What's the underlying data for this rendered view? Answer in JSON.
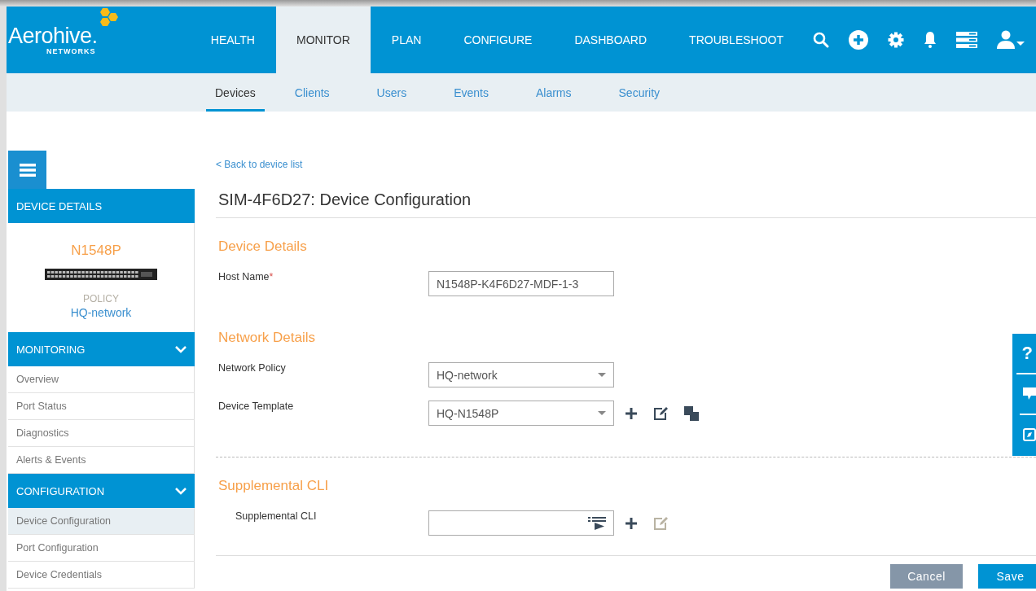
{
  "logo": {
    "name": "Aerohive.",
    "sub": "NETWORKS"
  },
  "nav": [
    {
      "label": "HEALTH",
      "selected": false
    },
    {
      "label": "MONITOR",
      "selected": true
    },
    {
      "label": "PLAN",
      "selected": false
    },
    {
      "label": "CONFIGURE",
      "selected": false
    },
    {
      "label": "DASHBOARD",
      "selected": false
    },
    {
      "label": "TROUBLESHOOT",
      "selected": false
    }
  ],
  "subnav": [
    {
      "label": "Devices",
      "selected": true
    },
    {
      "label": "Clients",
      "selected": false
    },
    {
      "label": "Users",
      "selected": false
    },
    {
      "label": "Events",
      "selected": false
    },
    {
      "label": "Alarms",
      "selected": false
    },
    {
      "label": "Security",
      "selected": false
    }
  ],
  "sidebar": {
    "header": "DEVICE DETAILS",
    "device": {
      "model": "N1548P",
      "policy_label": "POLICY",
      "policy": "HQ-network"
    },
    "sections": [
      {
        "title": "MONITORING",
        "expanded": true,
        "items": [
          {
            "label": "Overview",
            "selected": false
          },
          {
            "label": "Port Status",
            "selected": false
          },
          {
            "label": "Diagnostics",
            "selected": false
          },
          {
            "label": "Alerts & Events",
            "selected": false
          }
        ]
      },
      {
        "title": "CONFIGURATION",
        "expanded": true,
        "items": [
          {
            "label": "Device Configuration",
            "selected": true
          },
          {
            "label": "Port Configuration",
            "selected": false
          },
          {
            "label": "Device Credentials",
            "selected": false
          }
        ]
      }
    ]
  },
  "main": {
    "back_link": "< Back to device list",
    "title": "SIM-4F6D27: Device Configuration",
    "sections": [
      {
        "title": "Device Details",
        "fields": [
          {
            "kind": "text",
            "label": "Host Name",
            "required_mark": "*",
            "value": "N1548P-K4F6D27-MDF-1-3"
          }
        ]
      },
      {
        "title": "Network Details",
        "fields": [
          {
            "kind": "select",
            "label": "Network Policy",
            "value": "HQ-network"
          },
          {
            "kind": "select",
            "label": "Device Template",
            "value": "HQ-N1548P",
            "actions": [
              {
                "kind": "add",
                "disabled": false
              },
              {
                "kind": "edit",
                "disabled": false
              },
              {
                "kind": "clone",
                "disabled": false
              }
            ]
          }
        ]
      },
      {
        "title": "Supplemental CLI",
        "separated": true,
        "fields": [
          {
            "kind": "cli",
            "label": "Supplemental CLI",
            "actions": [
              {
                "kind": "add",
                "disabled": false
              },
              {
                "kind": "edit",
                "disabled": true
              }
            ]
          }
        ]
      }
    ],
    "buttons": [
      {
        "label": "Cancel",
        "kind": "secondary"
      },
      {
        "label": "Save",
        "kind": "primary"
      }
    ]
  },
  "side_panel": {
    "help_label": "?"
  }
}
